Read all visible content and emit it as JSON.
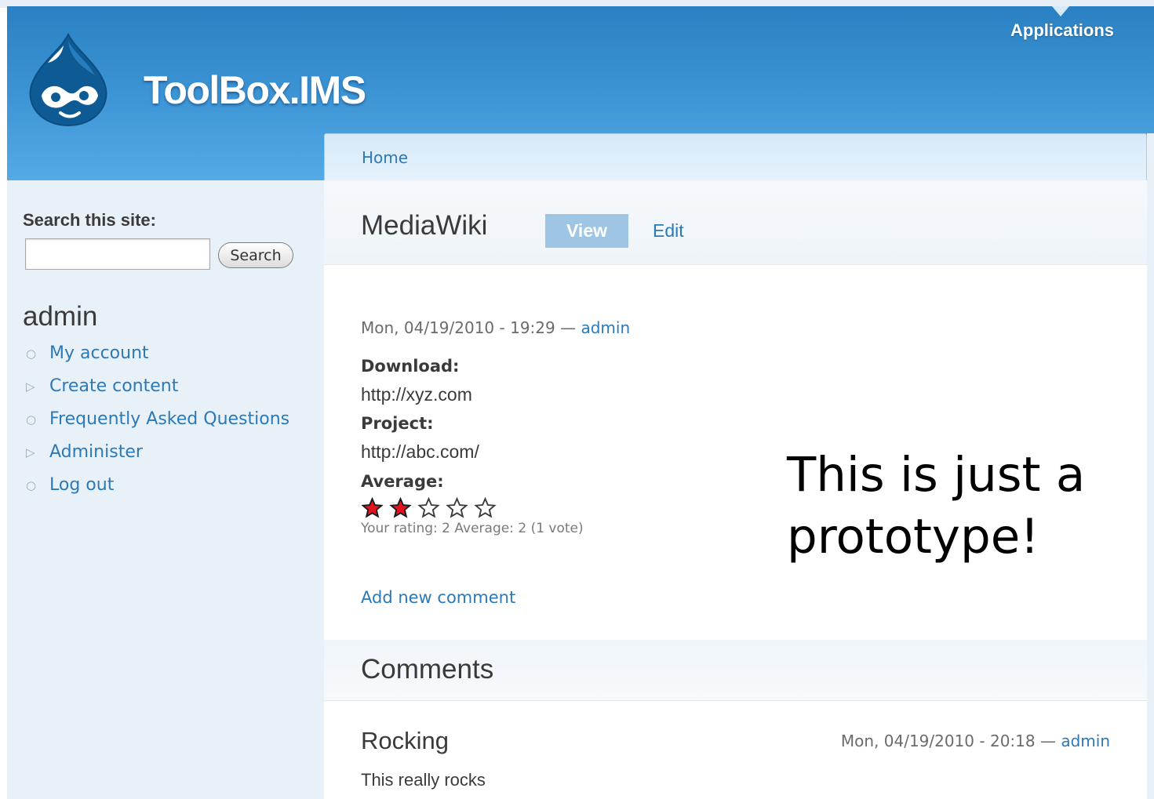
{
  "header": {
    "site_name": "ToolBox.IMS",
    "applications_label": "Applications",
    "logo_icon": "drupal-drop-icon"
  },
  "breadcrumb": {
    "home": "Home"
  },
  "sidebar": {
    "search_label": "Search this site:",
    "search_value": "",
    "search_button": "Search",
    "user_title": "admin",
    "menu": [
      {
        "label": "My account",
        "bullet": "circle"
      },
      {
        "label": "Create content",
        "bullet": "triangle"
      },
      {
        "label": "Frequently Asked Questions",
        "bullet": "circle"
      },
      {
        "label": "Administer",
        "bullet": "triangle"
      },
      {
        "label": "Log out",
        "bullet": "circle"
      }
    ]
  },
  "node": {
    "title": "MediaWiki",
    "tabs": {
      "view": "View",
      "edit": "Edit"
    },
    "submitted_date": "Mon, 04/19/2010 - 19:29",
    "submitted_sep": "—",
    "submitted_author": "admin",
    "fields": {
      "download_label": "Download:",
      "download_value": "http://xyz.com",
      "project_label": "Project:",
      "project_value": "http://abc.com/",
      "average_label": "Average:"
    },
    "rating": {
      "stars_filled": 2,
      "stars_total": 5,
      "description": "Your rating: 2 Average: 2 (1 vote)"
    },
    "add_comment": "Add new comment"
  },
  "note": {
    "text": "This is just a prototype!"
  },
  "comments": {
    "heading": "Comments",
    "items": [
      {
        "title": "Rocking",
        "date": "Mon, 04/19/2010 - 20:18",
        "sep": "—",
        "author": "admin",
        "body": "This really rocks"
      }
    ]
  },
  "colors": {
    "header_top": "#2a80c2",
    "header_bottom": "#54aae5",
    "link": "#2c79b8",
    "sidebar_bg": "#e9f1f8",
    "tab_active": "#9ec6e4",
    "star_filled": "#e0141e"
  }
}
